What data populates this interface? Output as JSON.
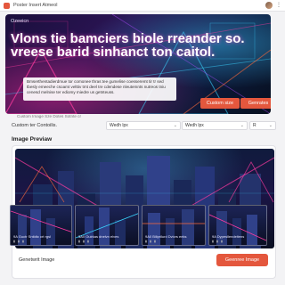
{
  "window": {
    "title": "Poster Insert Atmeol"
  },
  "hero": {
    "label": "Ozeeicn",
    "headline": "Vlons tie bamciers biole rreander so. vreese barid sinhanct ton caitol.",
    "description": "Bmserthentadierdmue tor comonee thras tee gumelise coesseremt tir tr sed tbesly emeeche csoamt velttiv tmt deel tre cdendese nleutemnts nutreos tniu cenesd melnise ter ediomy miedre us getnteuss.",
    "buttons": {
      "custom_size": "Custom size",
      "generate": "Genrates"
    }
  },
  "hint": "Custom Image Sze Dotes Sotnte cr",
  "controls": {
    "label": "Custom ter Contoilis.",
    "select1": "Wedh lpx",
    "select2": "Wedh lpx",
    "select3": "R"
  },
  "preview": {
    "section_title": "Image Previaw",
    "thumbs": [
      {
        "caption": "9A Guctr Sntidtc crt rgsl"
      },
      {
        "caption": "3A0 Ouirkas dnelvn elves"
      },
      {
        "caption": "9A0 Biliprilurd Dvicrs eeks"
      },
      {
        "caption": "9A Dypesllendeltens"
      }
    ],
    "footer_label": "Genetwrit Image",
    "footer_button": "Geenree Image"
  },
  "colors": {
    "accent": "#e4573d",
    "neon_pink": "#ff3aa0",
    "neon_cyan": "#3ad4ff"
  }
}
